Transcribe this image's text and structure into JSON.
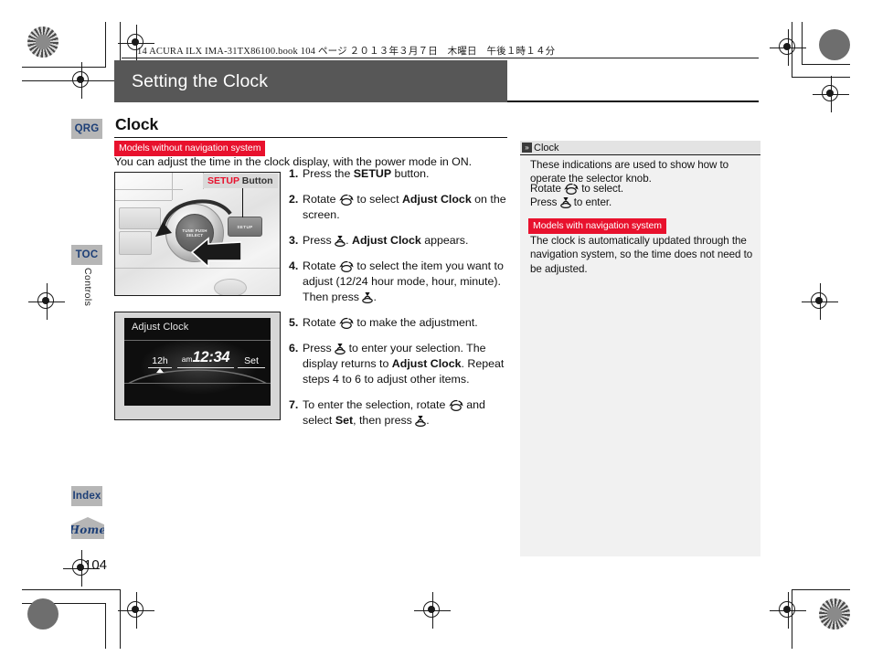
{
  "print_header": {
    "text": "14 ACURA ILX IMA-31TX86100.book   104 ページ  ２０１３年３月７日　木曜日　午後１時１４分"
  },
  "page_title": "Setting the Clock",
  "section": {
    "heading": "Clock",
    "badge_without_nav": "Models without navigation system",
    "intro": "You can adjust the time in the clock display, with the power mode in ON."
  },
  "figure_knob": {
    "callout_label_red": "SETUP",
    "callout_label_rest": " Button",
    "knob_text": "TUNE PUSH SELECT",
    "setup_button_text": "SETUP"
  },
  "figure_clock": {
    "title": "Adjust Clock",
    "hour_mode": "12h",
    "meridiem": "am",
    "time": "12:34",
    "set_label": "Set"
  },
  "steps": [
    {
      "num": "1.",
      "parts": [
        {
          "t": "text",
          "v": "Press the "
        },
        {
          "t": "bold",
          "v": "SETUP"
        },
        {
          "t": "text",
          "v": " button."
        }
      ]
    },
    {
      "num": "2.",
      "parts": [
        {
          "t": "text",
          "v": "Rotate "
        },
        {
          "t": "icon",
          "v": "rotate-knob-icon"
        },
        {
          "t": "text",
          "v": " to select "
        },
        {
          "t": "bold",
          "v": "Adjust Clock"
        },
        {
          "t": "text",
          "v": " on the screen."
        }
      ]
    },
    {
      "num": "3.",
      "parts": [
        {
          "t": "text",
          "v": "Press "
        },
        {
          "t": "icon",
          "v": "press-knob-icon"
        },
        {
          "t": "text",
          "v": ". "
        },
        {
          "t": "bold",
          "v": "Adjust Clock"
        },
        {
          "t": "text",
          "v": " appears."
        }
      ]
    },
    {
      "num": "4.",
      "parts": [
        {
          "t": "text",
          "v": "Rotate "
        },
        {
          "t": "icon",
          "v": "rotate-knob-icon"
        },
        {
          "t": "text",
          "v": " to select the item you want to adjust (12/24 hour mode, hour, minute). Then press "
        },
        {
          "t": "icon",
          "v": "press-knob-icon"
        },
        {
          "t": "text",
          "v": "."
        }
      ]
    },
    {
      "num": "5.",
      "parts": [
        {
          "t": "text",
          "v": "Rotate "
        },
        {
          "t": "icon",
          "v": "rotate-knob-icon"
        },
        {
          "t": "text",
          "v": " to make the adjustment."
        }
      ]
    },
    {
      "num": "6.",
      "parts": [
        {
          "t": "text",
          "v": "Press "
        },
        {
          "t": "icon",
          "v": "press-knob-icon"
        },
        {
          "t": "text",
          "v": " to enter your selection. The display returns to "
        },
        {
          "t": "bold",
          "v": "Adjust Clock"
        },
        {
          "t": "text",
          "v": ". Repeat steps 4 to 6 to adjust other items."
        }
      ]
    },
    {
      "num": "7.",
      "parts": [
        {
          "t": "text",
          "v": "To enter the selection, rotate "
        },
        {
          "t": "icon",
          "v": "rotate-knob-icon"
        },
        {
          "t": "text",
          "v": " and select "
        },
        {
          "t": "bold",
          "v": "Set"
        },
        {
          "t": "text",
          "v": ", then press "
        },
        {
          "t": "icon",
          "v": "press-knob-icon"
        },
        {
          "t": "text",
          "v": "."
        }
      ]
    }
  ],
  "info_panel": {
    "head_glyph": "»",
    "head_title": "Clock",
    "paragraph1": [
      {
        "t": "text",
        "v": "These indications are used to show how to operate the selector knob."
      }
    ],
    "line_rotate": [
      {
        "t": "text",
        "v": "Rotate "
      },
      {
        "t": "icon",
        "v": "rotate-knob-icon"
      },
      {
        "t": "text",
        "v": " to select."
      }
    ],
    "line_press": [
      {
        "t": "text",
        "v": "Press "
      },
      {
        "t": "icon",
        "v": "press-knob-icon"
      },
      {
        "t": "text",
        "v": " to enter."
      }
    ],
    "badge_with_nav": "Models with navigation system",
    "paragraph2": "The clock is automatically updated through the navigation system, so the time does not need to be adjusted."
  },
  "tabs": {
    "qrg": "QRG",
    "toc": "TOC",
    "chapter": "Controls",
    "index": "Index",
    "home": "Home"
  },
  "page_number": "104",
  "colors": {
    "title_bar": "#575757",
    "accent_red": "#e8112d",
    "tab_gray": "#b6b6b6",
    "tab_text_blue": "#1d3f77",
    "info_panel_bg": "#f1f1f1"
  }
}
